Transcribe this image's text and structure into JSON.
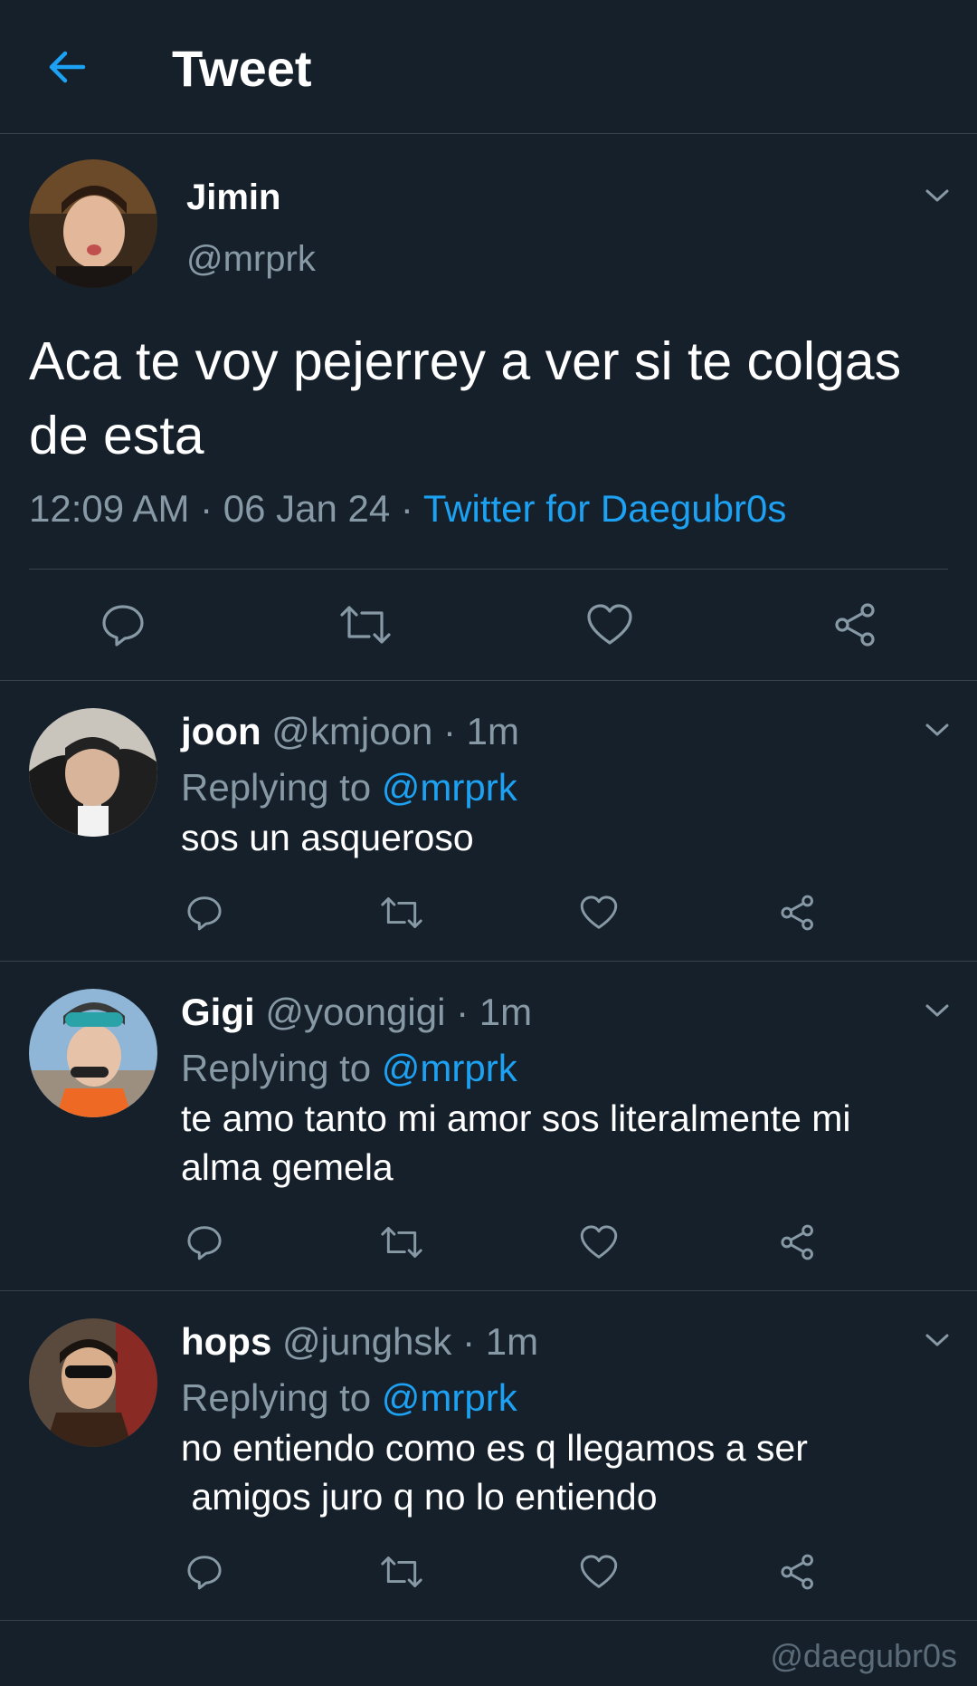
{
  "header": {
    "title": "Tweet",
    "back_icon": "arrow-left-icon",
    "accent": "#1da1f2"
  },
  "main_tweet": {
    "name": "Jimin",
    "handle": "@mrprk",
    "text": "Aca te voy pejerrey a ver si te colgas de esta",
    "time": "12:09 AM · 06 Jan 24 · ",
    "source": "Twitter for Daegubr0s"
  },
  "replies": [
    {
      "name": "joon",
      "handle_time": " @kmjoon · 1m",
      "replying_label": "Replying to ",
      "mention": "@mrprk",
      "text": "sos un asqueroso"
    },
    {
      "name": "Gigi",
      "handle_time": " @yoongigi · 1m",
      "replying_label": "Replying to ",
      "mention": "@mrprk",
      "text": "te amo tanto mi amor sos literalmente mi alma gemela"
    },
    {
      "name": "hops",
      "handle_time": " @junghsk · 1m",
      "replying_label": "Replying to ",
      "mention": "@mrprk",
      "text": "no entiendo como es q llegamos a ser\n amigos juro q no lo entiendo"
    }
  ],
  "watermark": "@daegubr0s",
  "colors": {
    "background": "#15202b",
    "divider": "#38444d",
    "secondary_text": "#8899a6",
    "link": "#1da1f2"
  }
}
